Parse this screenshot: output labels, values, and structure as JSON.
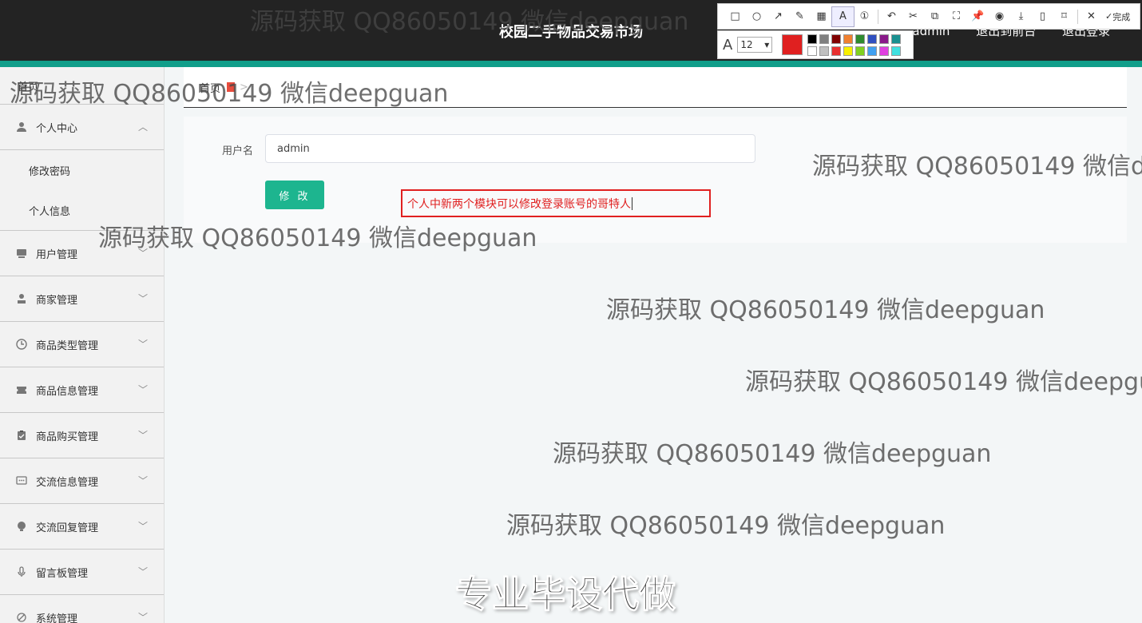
{
  "header": {
    "title": "校园二手物品交易市场",
    "user_label": "admin",
    "front_link": "退出到前台",
    "logout_link": "退出登录",
    "accent_color": "#119e8a"
  },
  "sidebar": {
    "home": "首页",
    "items": [
      {
        "label": "个人中心",
        "icon": "user-icon",
        "expanded": true,
        "children": [
          "修改密码",
          "个人信息"
        ]
      },
      {
        "label": "用户管理",
        "icon": "users-icon"
      },
      {
        "label": "商家管理",
        "icon": "merchant-icon"
      },
      {
        "label": "商品类型管理",
        "icon": "clock-icon"
      },
      {
        "label": "商品信息管理",
        "icon": "ticket-icon"
      },
      {
        "label": "商品购买管理",
        "icon": "clipboard-icon"
      },
      {
        "label": "交流信息管理",
        "icon": "chat-icon"
      },
      {
        "label": "交流回复管理",
        "icon": "bulb-icon"
      },
      {
        "label": "留言板管理",
        "icon": "mic-icon"
      },
      {
        "label": "系统管理",
        "icon": "settings-icon"
      }
    ]
  },
  "breadcrumb": {
    "home": "首页"
  },
  "form": {
    "username_label": "用户名",
    "username_value": "admin",
    "submit_label": "修 改",
    "button_color": "#1db58f"
  },
  "annotation": {
    "text": "个人中新两个模块可以修改登录账号的哥特人",
    "color": "#e02020",
    "toolbar_done": "完成",
    "font_size": "12",
    "palette": [
      "#000000",
      "#808080",
      "#800000",
      "#f08030",
      "#2e8b2e",
      "#3050c0",
      "#8a1a8a",
      "#1a9090",
      "#ffffff",
      "#c0c0c0",
      "#e83030",
      "#f8f000",
      "#80d020",
      "#40a0f0",
      "#e040e0",
      "#40e0e0"
    ]
  },
  "watermarks": {
    "text": "源码获取 QQ86050149 微信deepguan",
    "big": "专业毕设代做"
  }
}
